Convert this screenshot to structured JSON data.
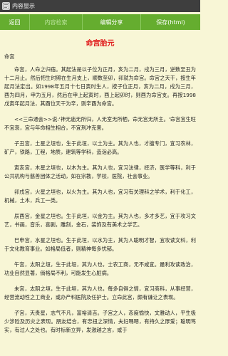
{
  "window": {
    "title": "内容显示"
  },
  "toolbar": {
    "back": "返回",
    "search_label": "内容检索",
    "share": "编辑分享",
    "save": "保存(html)"
  },
  "article": {
    "title": "命宫胎元",
    "subtitle": "命宫",
    "paragraphs": [
      "命宫，人命之归宿。其起法是以子位为正月，亥为二月，戌为三月，逆数至丑为十二月止。然后把生时照在生月支上，顺数至卯，卯就为命宫。命宫之天干，按生年起月法定出。如1998年五月十七日寅时生人，按子位正月，亥为二月，戌为三月，酉为四月，申为五月，然后在申上起寅时，酉上起卯时，则酉为命宫支。再按1998戊寅年起月法，其酉位天干为辛，则辛酉为命宫。",
      "<<三命通会>>说:'神无庙无所归，人无室无所栖，命无宫无所主。'命宫宜生旺不宜衰，宜与年命相生相合，不宜刑冲克害。",
      "子丑宫，土星之垣也，生于此垣，以土为主。其为人也，才擅专门，宜习农林，矿产，铁路，工程，地质，建筑等学科，造诣必高。",
      "寅亥宫，木星之垣也，以木为主。其为人也，宜习法律，经济，医学等科，利于公共机构与慈善团体之活动，如在宗教，学校，医院，社会事业。",
      "卯戌宫，火星之垣也，以火为主。其为人也，宜习有关理科之学术，利于化工，机械，土木，兵工一类。",
      "辰酉宫，金星之垣也。生于此垣，以金为主。其为人也，多才多艺，宜于攻习文艺，书画，音乐，喜剧，雕刻，金石，装饰及有美术之学艺。",
      "巳申宫，水星之垣也。生于此垣，以水为主，其为人聪明才智，宜攻读文科，利于文化教育事业。如格局低者，则精神每多忧郁。",
      "午宫，太阳之垣，生于此垣，其为人也，士农工商，无不咸宜。最利攻读政治，功业自然显著，倘格局不利，可能发生心脏病。",
      "未宫，太阴之垣，生于此垣，其为人也，每多自得之情，宜习商科，从事经营，经营流动性之工商业，或办产科医院及任护士。立命此宫，颇有谦让之表现。",
      "子宫，天贵星，志气不凡，富裕清吉。子宫之人，态度愉快，文雅动人，平生极少涉险及历灾之表现。朋友结合，有忠扭之深情，夫妇嗎嗯，有持久之厚爱；聪明笃实，有过人之处也。有时标新立异，发激越之言，或于"
    ]
  }
}
